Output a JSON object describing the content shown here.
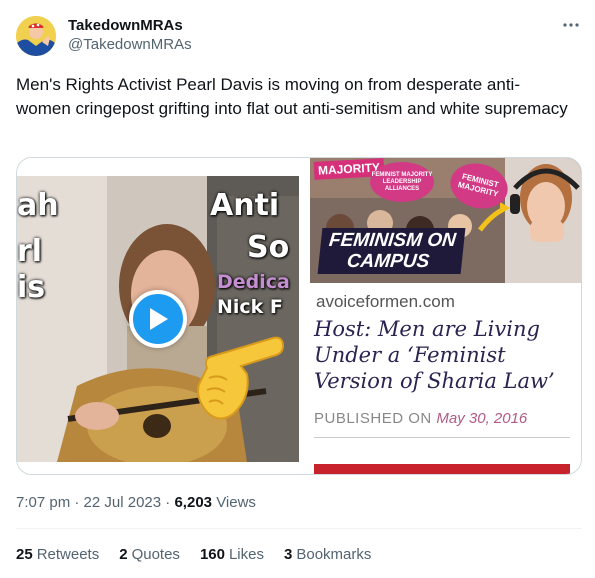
{
  "author": {
    "display_name": "TakedownMRAs",
    "handle": "@TakedownMRAs"
  },
  "more_icon": "more-horizontal-icon",
  "tweet": {
    "text": "Men's Rights Activist Pearl Davis is moving on from desperate anti-women cringepost grifting into flat out anti-semitism and white supremacy"
  },
  "media": {
    "video": {
      "overlay_left": [
        "ah",
        "rl",
        "is"
      ],
      "overlay_right": [
        "Anti",
        "So",
        "Dedica",
        "Nick F"
      ],
      "play_icon": "play-icon",
      "hand_icon": "pointing-hand-emoji"
    },
    "article": {
      "majority_tag": "MAJORITY",
      "sign_1": "FEMINIST MAJORITY LEADERSHIP ALLIANCES",
      "sign_2": "FEMINIST MAJORITY",
      "caption_line_1": "FEMINISM ON",
      "caption_line_2": "CAMPUS",
      "site": "avoiceformen.com",
      "headline": "Host: Men are Living Under a ‘Feminist Version of Sharia Law’",
      "published_label": "PUBLISHED ON",
      "published_date": "May 30, 2016"
    }
  },
  "meta": {
    "time": "7:07 pm",
    "sep1": "·",
    "date": "22 Jul 2023",
    "sep2": "·",
    "views": "6,203",
    "views_label": "Views"
  },
  "stats": {
    "retweets": "25",
    "retweets_label": "Retweets",
    "quotes": "2",
    "quotes_label": "Quotes",
    "likes": "160",
    "likes_label": "Likes",
    "bookmarks": "3",
    "bookmarks_label": "Bookmarks"
  },
  "colors": {
    "accent": "#1d9bf0",
    "text": "#0f1419",
    "secondary": "#536471",
    "border": "#cfd9de"
  }
}
